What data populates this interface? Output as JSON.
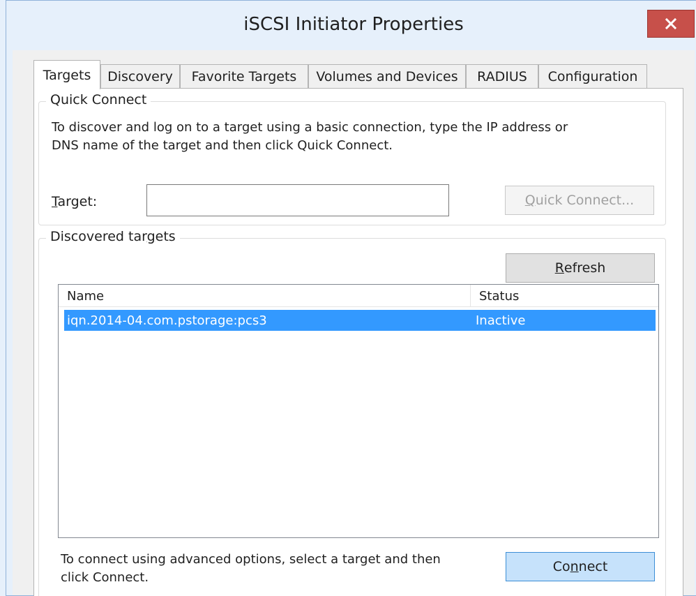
{
  "window": {
    "title": "iSCSI Initiator Properties",
    "close_glyph": "x"
  },
  "tabs": [
    {
      "label": "Targets",
      "active": true
    },
    {
      "label": "Discovery",
      "active": false
    },
    {
      "label": "Favorite Targets",
      "active": false
    },
    {
      "label": "Volumes and Devices",
      "active": false
    },
    {
      "label": "RADIUS",
      "active": false
    },
    {
      "label": "Configuration",
      "active": false
    }
  ],
  "quick_connect": {
    "group_title": "Quick Connect",
    "description_line1": "To discover and log on to a target using a basic connection, type the IP address or",
    "description_line2": "DNS name of the target and then click Quick Connect.",
    "target_label_accel": "T",
    "target_label_rest": "arget:",
    "target_value": "",
    "button_accel": "Q",
    "button_rest": "uick Connect...",
    "button_enabled": false
  },
  "discovered_targets": {
    "group_title_pre": "Discovered tar",
    "group_title_accel": "g",
    "group_title_post": "ets",
    "refresh_accel": "R",
    "refresh_rest": "efresh",
    "columns": [
      "Name",
      "Status"
    ],
    "rows": [
      {
        "name": "iqn.2014-04.com.pstorage:pcs3",
        "status": "Inactive",
        "selected": true
      }
    ],
    "connect_description_line1": "To connect using advanced options, select a target and then",
    "connect_description_line2": "click Connect.",
    "connect_pre": "Co",
    "connect_accel": "n",
    "connect_post": "nect"
  },
  "colors": {
    "selection": "#3399ff",
    "close_button": "#c7504a",
    "frame": "#e6f0fb"
  }
}
